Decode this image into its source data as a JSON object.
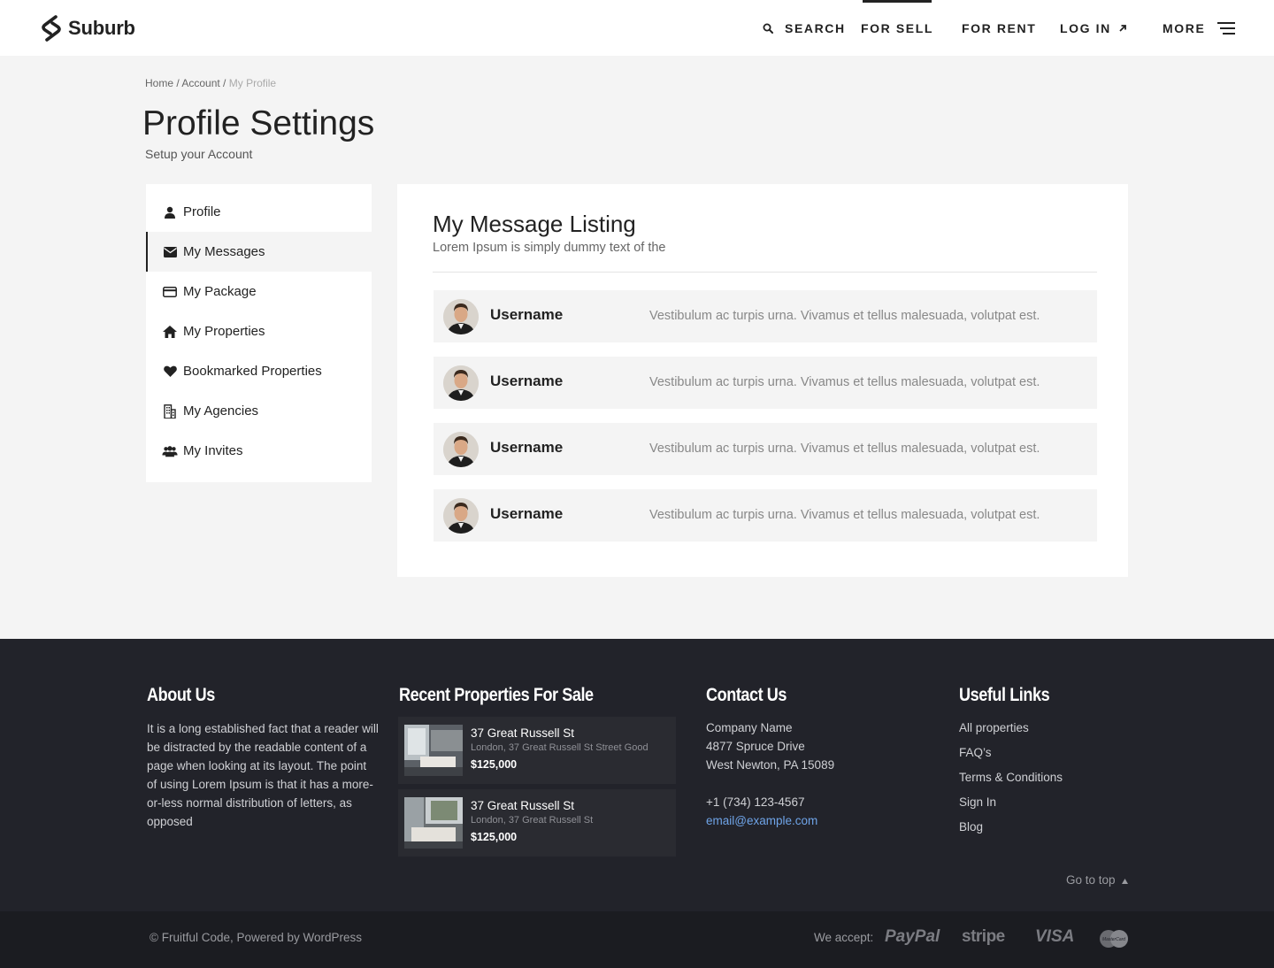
{
  "header": {
    "logo_text": "Suburb",
    "nav": {
      "search": "SEARCH",
      "for_sell": "FOR SELL",
      "for_rent": "FOR RENT",
      "log_in": "LOG IN",
      "more": "MORE"
    }
  },
  "breadcrumb": {
    "home": "Home",
    "sep1": " / ",
    "account": "Account",
    "sep2": " / ",
    "current": "My Profile"
  },
  "page": {
    "title": "Profile Settings",
    "subtitle": "Setup your Account"
  },
  "sidebar": {
    "items": [
      {
        "label": "Profile",
        "icon": "user-icon"
      },
      {
        "label": "My Messages",
        "icon": "envelope-icon",
        "active": true
      },
      {
        "label": "My Package",
        "icon": "credit-card-icon"
      },
      {
        "label": "My Properties",
        "icon": "home-icon"
      },
      {
        "label": "Bookmarked Properties",
        "icon": "heart-icon"
      },
      {
        "label": "My Agencies",
        "icon": "building-icon"
      },
      {
        "label": "My Invites",
        "icon": "users-icon"
      }
    ]
  },
  "messages": {
    "title": "My Message Listing",
    "subtitle": "Lorem Ipsum is simply dummy text of the",
    "rows": [
      {
        "username": "Username",
        "text": "Vestibulum ac turpis urna. Vivamus et tellus malesuada, volutpat est."
      },
      {
        "username": "Username",
        "text": "Vestibulum ac turpis urna. Vivamus et tellus malesuada, volutpat est."
      },
      {
        "username": "Username",
        "text": "Vestibulum ac turpis urna. Vivamus et tellus malesuada, volutpat est."
      },
      {
        "username": "Username",
        "text": "Vestibulum ac turpis urna. Vivamus et tellus malesuada, volutpat est."
      }
    ]
  },
  "footer": {
    "about": {
      "heading": "About Us",
      "text": "It is a long established fact that a reader will be distracted by the readable content of a page when looking at its layout. The point of using Lorem Ipsum is that it has a more-or-less normal distribution of letters, as opposed"
    },
    "recent": {
      "heading": "Recent Properties For Sale",
      "items": [
        {
          "title": "37 Great Russell St",
          "address": "London, 37 Great Russell St Street Good",
          "price": "$125,000"
        },
        {
          "title": "37 Great Russell St",
          "address": "London, 37 Great Russell St",
          "price": "$125,000"
        }
      ]
    },
    "contact": {
      "heading": "Contact Us",
      "company": "Company Name",
      "street": "4877 Spruce Drive",
      "city": "West Newton, PA 15089",
      "phone": "+1 (734) 123-4567",
      "email": "email@example.com"
    },
    "links": {
      "heading": "Useful Links",
      "items": [
        "All properties",
        "FAQ’s",
        "Terms & Conditions",
        "Sign In",
        "Blog"
      ]
    },
    "go_to_top": "Go to top",
    "copyright": "© Fruitful Code, Powered by WordPress",
    "accept_label": "We accept:",
    "payments": {
      "paypal": "PayPal",
      "stripe": "stripe",
      "visa": "VISA",
      "mastercard": "MasterCard"
    }
  },
  "colors": {
    "footer_bg": "#22232a",
    "bottom_bar_bg": "#1b1c21",
    "email_link": "#6fa4e8"
  }
}
